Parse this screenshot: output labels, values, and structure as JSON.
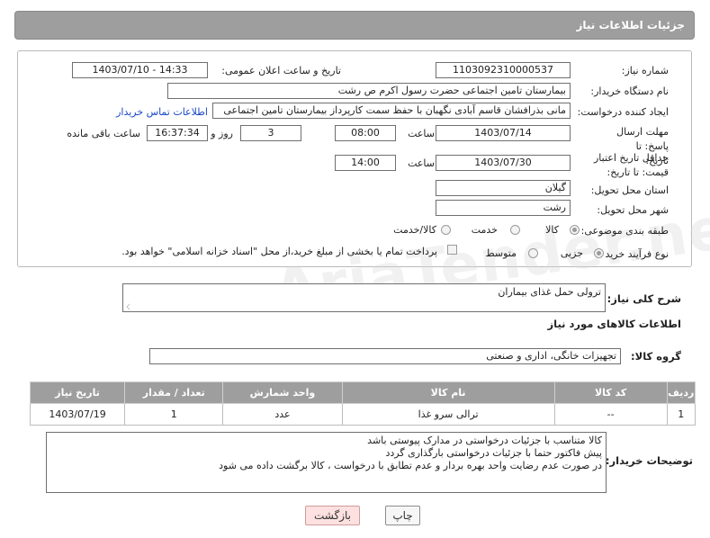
{
  "header": {
    "title": "جزئیات اطلاعات نیاز"
  },
  "fields": {
    "need_number_label": "شماره نیاز:",
    "need_number": "1103092310000537",
    "announce_label": "تاریخ و ساعت اعلان عمومی:",
    "announce_value": "1403/07/10 - 14:33",
    "buyer_label": "نام دستگاه خریدار:",
    "buyer_value": "بیمارستان  تامین اجتماعی حضرت رسول اکرم ص رشت",
    "creator_label": "ایجاد کننده درخواست:",
    "creator_value": "مانی بذرافشان قاسم آبادی نگهبان با حفظ سمت کارپرداز بیمارستان  تامین اجتماعی",
    "contact_link": "اطلاعات تماس خریدار",
    "reply_deadline_label": "مهلت ارسال پاسخ: تا تاریخ:",
    "reply_date": "1403/07/14",
    "time_label": "ساعت",
    "reply_time": "08:00",
    "days_value": "3",
    "days_label": "روز و",
    "remaining_time": "16:37:34",
    "remaining_label": "ساعت باقی مانده",
    "price_validity_label": "حداقل تاریخ اعتبار قیمت: تا تاریخ:",
    "price_date": "1403/07/30",
    "price_time_label": "ساعت",
    "price_time": "14:00",
    "province_label": "استان محل تحویل:",
    "province_value": "گیلان",
    "city_label": "شهر محل تحویل:",
    "city_value": "رشت",
    "category_label": "طبقه بندی موضوعی:",
    "category_options": [
      "کالا",
      "خدمت",
      "کالا/خدمت"
    ],
    "process_label": "نوع فرآیند خرید :",
    "process_options": [
      "جزیی",
      "متوسط"
    ],
    "payment_note": "پرداخت تمام یا بخشی از مبلغ خرید،از محل \"اسناد خزانه اسلامی\" خواهد بود."
  },
  "description": {
    "label": "شرح کلی نیاز:",
    "value": "ترولی حمل غذای بیماران"
  },
  "goods_section_title": "اطلاعات کالاهای مورد نیاز",
  "goods_group": {
    "label": "گروه کالا:",
    "value": "تجهیزات خانگی، اداری و صنعتی"
  },
  "table": {
    "headers": [
      "ردیف",
      "کد کالا",
      "نام کالا",
      "واحد شمارش",
      "تعداد / مقدار",
      "تاریخ نیاز"
    ],
    "rows": [
      [
        "1",
        "--",
        "ترالی سرو غذا",
        "عدد",
        "1",
        "1403/07/19"
      ]
    ]
  },
  "buyer_notes": {
    "label": "توضیحات خریدار:",
    "lines": [
      "کالا متناسب با جزئیات درخواستی در مدارک پیوستی باشد",
      "پیش فاکتور حتما با جزئیات درخواستی بارگذاری گردد",
      "در صورت عدم رضایت واحد بهره بردار و عدم تطابق با درخواست ، کالا برگشت داده می شود"
    ]
  },
  "buttons": {
    "print": "چاپ",
    "back": "بازگشت"
  },
  "watermark": "AriaTender.neT"
}
